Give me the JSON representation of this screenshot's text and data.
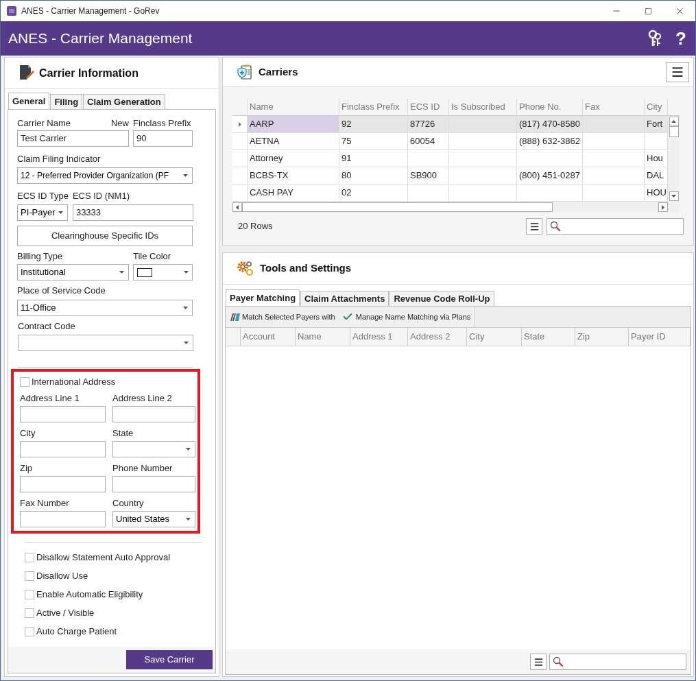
{
  "window": {
    "title": "ANES - Carrier Management - GoRev"
  },
  "header": {
    "title": "ANES - Carrier Management",
    "help": "?"
  },
  "carrier_panel": {
    "title": "Carrier Information",
    "tabs": [
      {
        "label": "General",
        "selected": true
      },
      {
        "label": "Filing",
        "selected": false
      },
      {
        "label": "Claim Generation",
        "selected": false
      }
    ],
    "carrier_name": {
      "label": "Carrier Name",
      "value": "Test Carrier"
    },
    "new_label": "New",
    "finclass_prefix": {
      "label": "Finclass Prefix",
      "value": "90"
    },
    "claim_filing_indicator": {
      "label": "Claim Filing Indicator",
      "value": "12 - Preferred Provider Organization (PF"
    },
    "ecs_id_type": {
      "label": "ECS ID Type",
      "value": "PI-Payer"
    },
    "ecs_id": {
      "label": "ECS ID (NM1)",
      "value": "33333"
    },
    "clearinghouse_button": "Clearinghouse Specific IDs",
    "billing_type": {
      "label": "Billing Type",
      "value": "Institutional"
    },
    "tile_color": {
      "label": "Tile Color"
    },
    "place_of_service": {
      "label": "Place of Service Code",
      "value": "11-Office"
    },
    "contract_code": {
      "label": "Contract Code"
    },
    "address": {
      "international": {
        "label": "International Address",
        "checked": false
      },
      "fields": [
        {
          "label": "Address Line 1",
          "kind": "text"
        },
        {
          "label": "Address Line 2",
          "kind": "text"
        },
        {
          "label": "City",
          "kind": "text"
        },
        {
          "label": "State",
          "kind": "select"
        },
        {
          "label": "Zip",
          "kind": "text"
        },
        {
          "label": "Phone Number",
          "kind": "text"
        },
        {
          "label": "Fax Number",
          "kind": "text"
        },
        {
          "label": "Country",
          "kind": "select",
          "value": "United States"
        }
      ]
    },
    "options": [
      {
        "label": "Disallow Statement Auto Approval",
        "checked": false
      },
      {
        "label": "Disallow Use",
        "checked": false
      },
      {
        "label": "Enable Automatic Eligibility",
        "checked": false
      },
      {
        "label": "Active / Visible",
        "checked": false
      },
      {
        "label": "Auto Charge Patient",
        "checked": false
      }
    ],
    "save_button": "Save Carrier"
  },
  "carriers": {
    "title": "Carriers",
    "columns": [
      "Name",
      "Finclass Prefix",
      "ECS ID",
      "Is Subscribed",
      "Phone No.",
      "Fax",
      "City"
    ],
    "rows": [
      {
        "selected": true,
        "cells": [
          "AARP",
          "92",
          "87726",
          "",
          "(817) 470-8580",
          "",
          "Fort"
        ]
      },
      {
        "selected": false,
        "cells": [
          "AETNA",
          "75",
          "60054",
          "",
          "(888) 632-3862",
          "",
          ""
        ]
      },
      {
        "selected": false,
        "cells": [
          "Attorney",
          "91",
          "",
          "",
          "",
          "",
          "Hou"
        ]
      },
      {
        "selected": false,
        "cells": [
          "BCBS-TX",
          "80",
          "SB900",
          "",
          "(800) 451-0287",
          "",
          "DAL"
        ]
      },
      {
        "selected": false,
        "cells": [
          "CASH PAY",
          "02",
          "",
          "",
          "",
          "",
          "HOU"
        ]
      }
    ],
    "row_count": "20 Rows"
  },
  "tools": {
    "title": "Tools and Settings",
    "tabs": [
      {
        "label": "Payer Matching",
        "selected": true
      },
      {
        "label": "Claim Attachments",
        "selected": false
      },
      {
        "label": "Revenue Code Roll-Up",
        "selected": false
      }
    ],
    "actions": [
      "Match Selected Payers with",
      "Manage Name Matching via Plans"
    ],
    "columns": [
      "Account",
      "Name",
      "Address 1",
      "Address 2",
      "City",
      "State",
      "Zip",
      "Payer ID"
    ]
  }
}
